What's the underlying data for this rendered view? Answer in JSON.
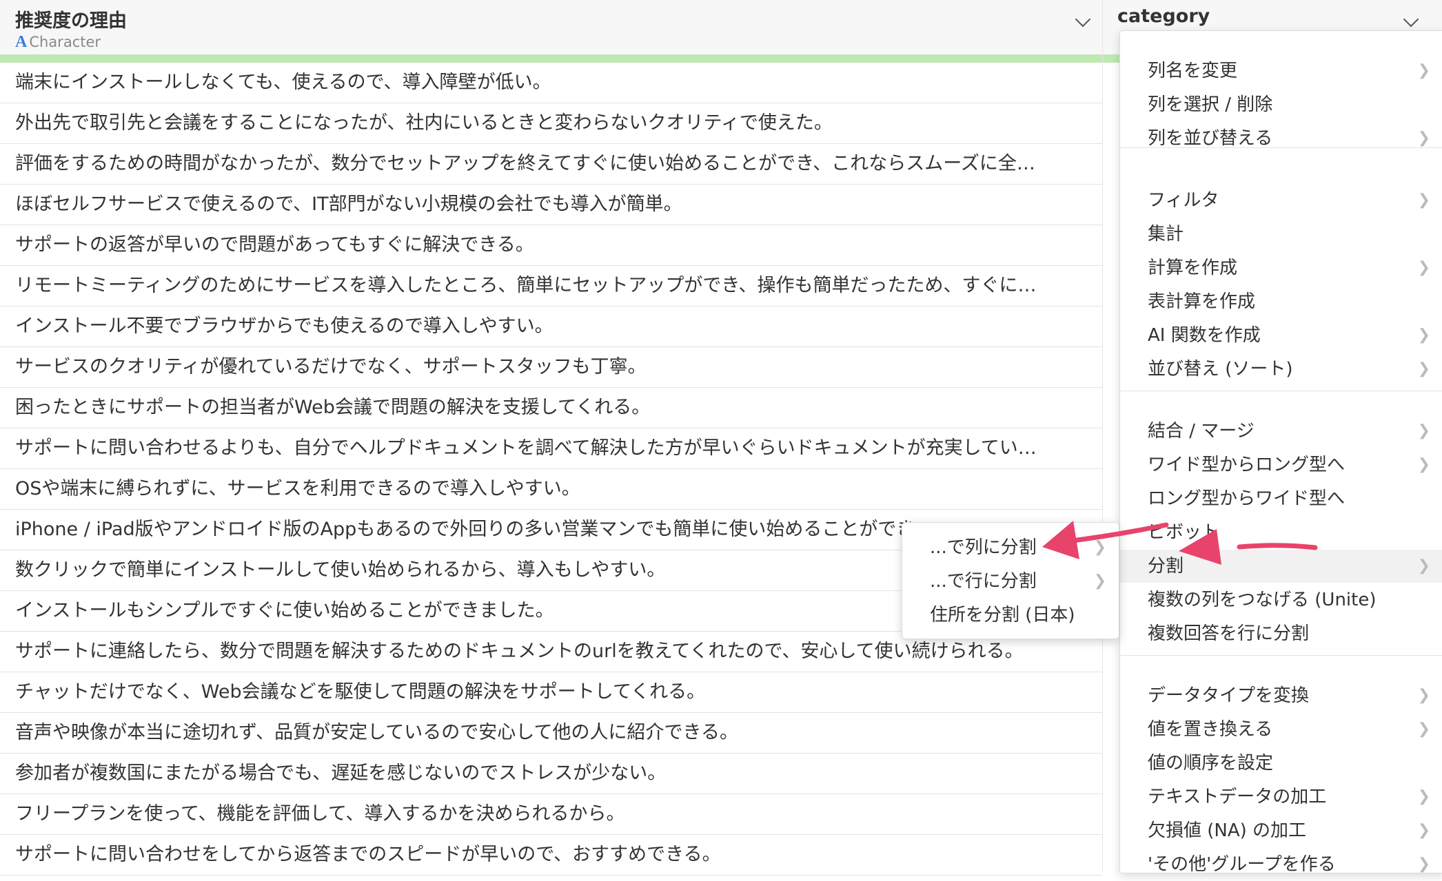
{
  "columns": {
    "main": {
      "name": "推奨度の理由",
      "type_glyph": "A",
      "type_label": "Character"
    },
    "category": {
      "name": "category"
    }
  },
  "rows": [
    "端末にインストールしなくても、使えるので、導入障壁が低い。",
    "外出先で取引先と会議をすることになったが、社内にいるときと変わらないクオリティで使えた。",
    "評価をするための時間がなかったが、数分でセットアップを終えてすぐに使い始めることができ、これならスムーズに全…",
    "ほぼセルフサービスで使えるので、IT部門がない小規模の会社でも導入が簡単。",
    "サポートの返答が早いので問題があってもすぐに解決できる。",
    "リモートミーティングのためにサービスを導入したところ、簡単にセットアップができ、操作も簡単だったため、すぐに…",
    "インストール不要でブラウザからでも使えるので導入しやすい。",
    "サービスのクオリティが優れているだけでなく、サポートスタッフも丁寧。",
    "困ったときにサポートの担当者がWeb会議で問題の解決を支援してくれる。",
    "サポートに問い合わせるよりも、自分でヘルプドキュメントを調べて解決した方が早いぐらいドキュメントが充実してい…",
    "OSや端末に縛られずに、サービスを利用できるので導入しやすい。",
    "iPhone / iPad版やアンドロイド版のAppもあるので外回りの多い営業マンでも簡単に使い始めることができ",
    "数クリックで簡単にインストールして使い始められるから、導入もしやすい。",
    "インストールもシンプルですぐに使い始めることができました。",
    "サポートに連絡したら、数分で問題を解決するためのドキュメントのurlを教えてくれたので、安心して使い続けられる。",
    "チャットだけでなく、Web会議などを駆使して問題の解決をサポートしてくれる。",
    "音声や映像が本当に途切れず、品質が安定しているので安心して他の人に紹介できる。",
    "参加者が複数国にまたがる場合でも、遅延を感じないのでストレスが少ない。",
    "フリープランを使って、機能を評価して、導入するかを決められるから。",
    "サポートに問い合わせをしてから返答までのスピードが早いので、おすすめできる。"
  ],
  "menu": {
    "items": [
      {
        "label": "列名を変更",
        "submenu": true
      },
      {
        "label": "列を選択 / 削除",
        "submenu": false
      },
      {
        "label": "列を並び替える",
        "submenu": true
      },
      {
        "label": "フィルタ",
        "submenu": true
      },
      {
        "label": "集計",
        "submenu": false
      },
      {
        "label": "計算を作成",
        "submenu": true
      },
      {
        "label": "表計算を作成",
        "submenu": false
      },
      {
        "label": "AI 関数を作成",
        "submenu": true
      },
      {
        "label": "並び替え (ソート)",
        "submenu": true
      },
      {
        "label": "結合 / マージ",
        "submenu": true
      },
      {
        "label": "ワイド型からロング型へ",
        "submenu": true
      },
      {
        "label": "ロング型からワイド型へ",
        "submenu": false
      },
      {
        "label": "ピボット",
        "submenu": false
      },
      {
        "label": "分割",
        "submenu": true
      },
      {
        "label": "複数の列をつなげる (Unite)",
        "submenu": false
      },
      {
        "label": "複数回答を行に分割",
        "submenu": false
      },
      {
        "label": "データタイプを変換",
        "submenu": true
      },
      {
        "label": "値を置き換える",
        "submenu": true
      },
      {
        "label": "値の順序を設定",
        "submenu": false
      },
      {
        "label": "テキストデータの加工",
        "submenu": true
      },
      {
        "label": "欠損値 (NA) の加工",
        "submenu": true
      },
      {
        "label": "'その他'グループを作る",
        "submenu": true
      }
    ],
    "selected": "分割"
  },
  "submenu": {
    "items": [
      {
        "label": "...で列に分割",
        "submenu": true
      },
      {
        "label": "...で行に分割",
        "submenu": true
      },
      {
        "label": "住所を分割 (日本)",
        "submenu": false
      }
    ]
  },
  "colors": {
    "accent": "#e8436b",
    "quality_bar": "#bfe9b3",
    "type_icon": "#3b7dd8"
  }
}
